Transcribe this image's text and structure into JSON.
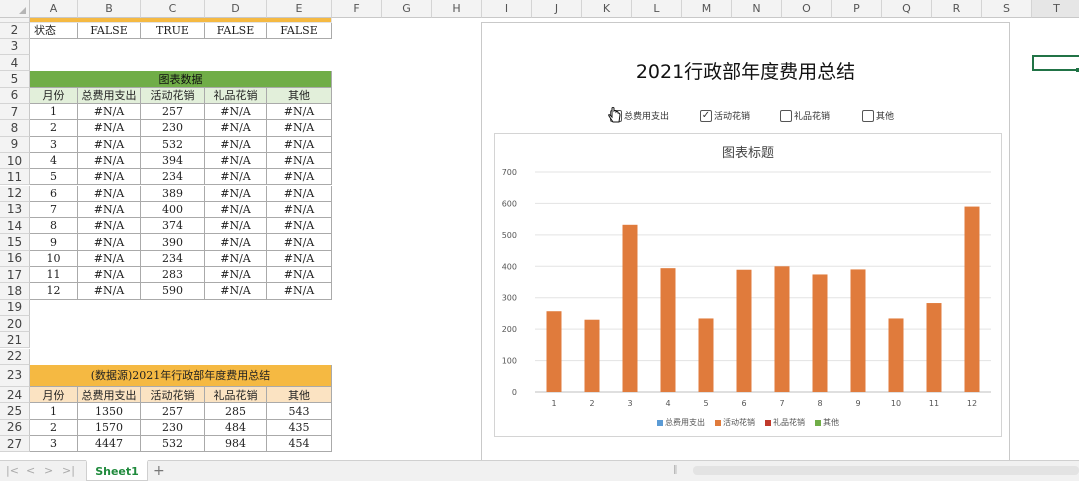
{
  "columns": [
    "A",
    "B",
    "C",
    "D",
    "E",
    "F",
    "G",
    "H",
    "I",
    "J",
    "K",
    "L",
    "M",
    "N",
    "O",
    "P",
    "Q",
    "R",
    "S",
    "T"
  ],
  "rows": [
    "2",
    "3",
    "4",
    "5",
    "6",
    "7",
    "8",
    "9",
    "10",
    "11",
    "12",
    "13",
    "14",
    "15",
    "16",
    "17",
    "18",
    "19",
    "20",
    "21",
    "22",
    "23",
    "24",
    "25",
    "26",
    "27"
  ],
  "status_row": {
    "label": "状态",
    "values": [
      "FALSE",
      "TRUE",
      "FALSE",
      "FALSE"
    ]
  },
  "table1": {
    "title": "图表数据",
    "headers": [
      "月份",
      "总费用支出",
      "活动花销",
      "礼品花销",
      "其他"
    ],
    "rows": [
      [
        "1",
        "#N/A",
        "257",
        "#N/A",
        "#N/A"
      ],
      [
        "2",
        "#N/A",
        "230",
        "#N/A",
        "#N/A"
      ],
      [
        "3",
        "#N/A",
        "532",
        "#N/A",
        "#N/A"
      ],
      [
        "4",
        "#N/A",
        "394",
        "#N/A",
        "#N/A"
      ],
      [
        "5",
        "#N/A",
        "234",
        "#N/A",
        "#N/A"
      ],
      [
        "6",
        "#N/A",
        "389",
        "#N/A",
        "#N/A"
      ],
      [
        "7",
        "#N/A",
        "400",
        "#N/A",
        "#N/A"
      ],
      [
        "8",
        "#N/A",
        "374",
        "#N/A",
        "#N/A"
      ],
      [
        "9",
        "#N/A",
        "390",
        "#N/A",
        "#N/A"
      ],
      [
        "10",
        "#N/A",
        "234",
        "#N/A",
        "#N/A"
      ],
      [
        "11",
        "#N/A",
        "283",
        "#N/A",
        "#N/A"
      ],
      [
        "12",
        "#N/A",
        "590",
        "#N/A",
        "#N/A"
      ]
    ]
  },
  "table2": {
    "title": "(数据源)2021年行政部年度费用总结",
    "headers": [
      "月份",
      "总费用支出",
      "活动花销",
      "礼品花销",
      "其他"
    ],
    "rows": [
      [
        "1",
        "1350",
        "257",
        "285",
        "543"
      ],
      [
        "2",
        "1570",
        "230",
        "484",
        "435"
      ],
      [
        "3",
        "4447",
        "532",
        "984",
        "454"
      ]
    ]
  },
  "chart_panel": {
    "title": "2021行政部年度费用总结",
    "checkboxes": [
      {
        "label": "总费用支出",
        "checked": false
      },
      {
        "label": "活动花销",
        "checked": true
      },
      {
        "label": "礼品花销",
        "checked": false
      },
      {
        "label": "其他",
        "checked": false
      }
    ]
  },
  "chart_data": {
    "type": "bar",
    "title": "图表标题",
    "categories": [
      "1",
      "2",
      "3",
      "4",
      "5",
      "6",
      "7",
      "8",
      "9",
      "10",
      "11",
      "12"
    ],
    "series": [
      {
        "name": "活动花销",
        "color": "#e07b3c",
        "values": [
          257,
          230,
          532,
          394,
          234,
          389,
          400,
          374,
          390,
          234,
          283,
          590
        ]
      }
    ],
    "legend": [
      {
        "name": "总费用支出",
        "color": "#5b9bd5"
      },
      {
        "name": "活动花销",
        "color": "#e07b3c"
      },
      {
        "name": "礼品花销",
        "color": "#c0392b"
      },
      {
        "name": "其他",
        "color": "#70ad47"
      }
    ],
    "ylim": [
      0,
      700
    ],
    "yticks": [
      0,
      100,
      200,
      300,
      400,
      500,
      600,
      700
    ],
    "legend_position": "bottom",
    "grid": true
  },
  "tabs": {
    "active": "Sheet1",
    "add_label": "+",
    "nav": [
      "|<",
      "<",
      ">",
      ">|"
    ]
  }
}
